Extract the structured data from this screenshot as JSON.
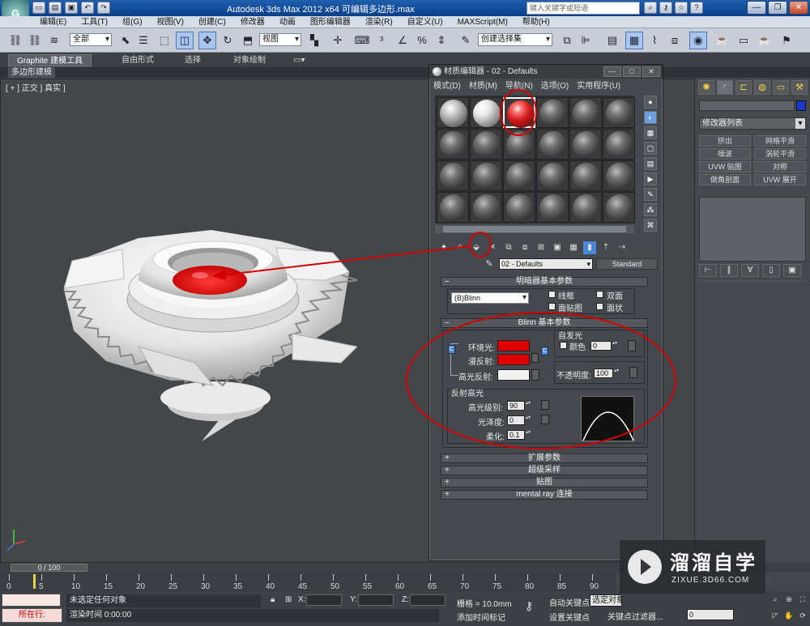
{
  "app": {
    "title": "Autodesk 3ds Max  2012 x64      可编辑多边形.max",
    "logo_text": "G",
    "search_placeholder": "键入关键字或短语"
  },
  "quick_access": [
    "new-icon",
    "open-icon",
    "save-icon",
    "undo-icon",
    "redo-icon"
  ],
  "menubar": [
    "编辑(E)",
    "工具(T)",
    "组(G)",
    "视图(V)",
    "创建(C)",
    "修改器",
    "动画",
    "图形编辑器",
    "渲染(R)",
    "自定义(U)",
    "MAXScript(M)",
    "帮助(H)"
  ],
  "toolbar": {
    "filter_value": "全部",
    "ref_coord_value": "视图",
    "named_selection_value": "创建选择集"
  },
  "ribbon": {
    "tabs": [
      "Graphite 建模工具",
      "自由形式",
      "选择",
      "对象绘制"
    ],
    "sub_label": "多边形建模"
  },
  "viewport": {
    "label": "[ + ] 正交 ] 真实 ]"
  },
  "command_panel": {
    "modifier_list": "修改器列表",
    "buttons": [
      "挤出",
      "网格平滑",
      "噪波",
      "涡轮平滑",
      "UVW 贴图",
      "对称",
      "倒角剖面",
      "UVW 展开"
    ]
  },
  "material_editor": {
    "title": "材质编辑器 - 02 - Defaults",
    "menu": [
      "模式(D)",
      "材质(M)",
      "导航(N)",
      "选项(O)",
      "实用程序(U)"
    ],
    "material_name": "02 - Defaults",
    "material_type": "Standard",
    "shader_basic": {
      "header": "明暗器基本参数",
      "shader": "(B)Blinn",
      "wire": "线框",
      "two_sided": "双面",
      "face_map": "面贴图",
      "faceted": "面状"
    },
    "blinn_basic": {
      "header": "Blinn 基本参数",
      "self_illum": "自发光",
      "color_label": "颜色",
      "self_illum_value": "0",
      "ambient": "环境光:",
      "diffuse": "漫反射:",
      "specular": "高光反射:",
      "opacity_label": "不透明度:",
      "opacity_value": "100",
      "ambient_color": "#e00000",
      "diffuse_color": "#e00000",
      "specular_color": "#f2f2f2"
    },
    "spec_highlights": {
      "header": "反射高光",
      "level_label": "高光级别:",
      "level_value": "90",
      "gloss_label": "光泽度:",
      "gloss_value": "0",
      "soften_label": "柔化:",
      "soften_value": "0.1"
    },
    "rollouts": [
      "扩展参数",
      "超级采样",
      "贴图",
      "mental ray 连接"
    ]
  },
  "timeline": {
    "frame_display": "0 / 100",
    "ticks": [
      "0",
      "5",
      "10",
      "15",
      "20",
      "25",
      "30",
      "35",
      "40",
      "45",
      "50",
      "55",
      "60",
      "65",
      "70",
      "75",
      "80",
      "85",
      "90"
    ]
  },
  "status": {
    "running": "所在行:",
    "message": "未选定任何对象",
    "render_time": "渲染时间  0:00:00",
    "x_label": "X:",
    "y_label": "Y:",
    "z_label": "Z:",
    "grid": "栅格 = 10.0mm",
    "auto_key": "自动关键点",
    "selected": "选定对象",
    "set_key": "设置关键点",
    "key_filters": "关键点过滤器...",
    "add_time_tag": "添加时间标记",
    "frame_value": "0"
  },
  "watermark": {
    "title": "溜溜自学",
    "url": "ZIXUE.3D66.COM"
  },
  "annotation_color": "#d40000"
}
